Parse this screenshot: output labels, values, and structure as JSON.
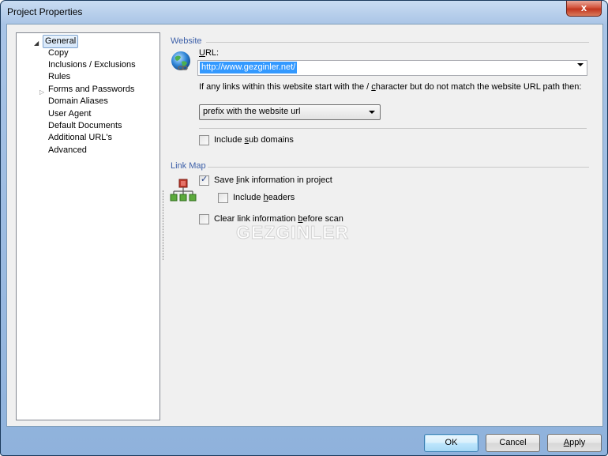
{
  "window": {
    "title": "Project Properties",
    "close_glyph": "x"
  },
  "tree": {
    "items": [
      {
        "label": "General",
        "selected": true,
        "expanded": true
      },
      {
        "label": "Copy"
      },
      {
        "label": "Inclusions / Exclusions"
      },
      {
        "label": "Rules"
      },
      {
        "label": "Forms and Passwords",
        "has_children": true
      },
      {
        "label": "Domain Aliases"
      },
      {
        "label": "User Agent"
      },
      {
        "label": "Default Documents"
      },
      {
        "label": "Additional URL's"
      },
      {
        "label": "Advanced"
      }
    ]
  },
  "website": {
    "section_label": "Website",
    "url_label_pre": "",
    "url_label_key": "U",
    "url_label_post": "RL:",
    "url_value": "http://www.gezginler.net/",
    "hint_pre": "If any links within this website start with the / ",
    "hint_key": "c",
    "hint_post": "haracter but do not match the website URL path then:",
    "mismatch_option": "prefix with the website url",
    "include_subdomains": {
      "pre": "Include ",
      "key": "s",
      "post": "ub domains",
      "checked": false
    }
  },
  "link_map": {
    "section_label": "Link Map",
    "save_link_info": {
      "pre": "Save ",
      "key": "l",
      "post": "ink information in project",
      "checked": true
    },
    "include_headers": {
      "pre": "Include ",
      "key": "h",
      "post": "eaders",
      "checked": false
    },
    "clear_link_info": {
      "pre": "Clear link information ",
      "key": "b",
      "post": "efore scan",
      "checked": false
    }
  },
  "watermark_text": "GEZGINLER",
  "buttons": {
    "ok": "OK",
    "cancel": "Cancel",
    "apply_key": "A",
    "apply_rest": "pply"
  },
  "colors": {
    "accent": "#3c5fa8",
    "selection": "#3399ff",
    "check": "#1f3e83"
  }
}
